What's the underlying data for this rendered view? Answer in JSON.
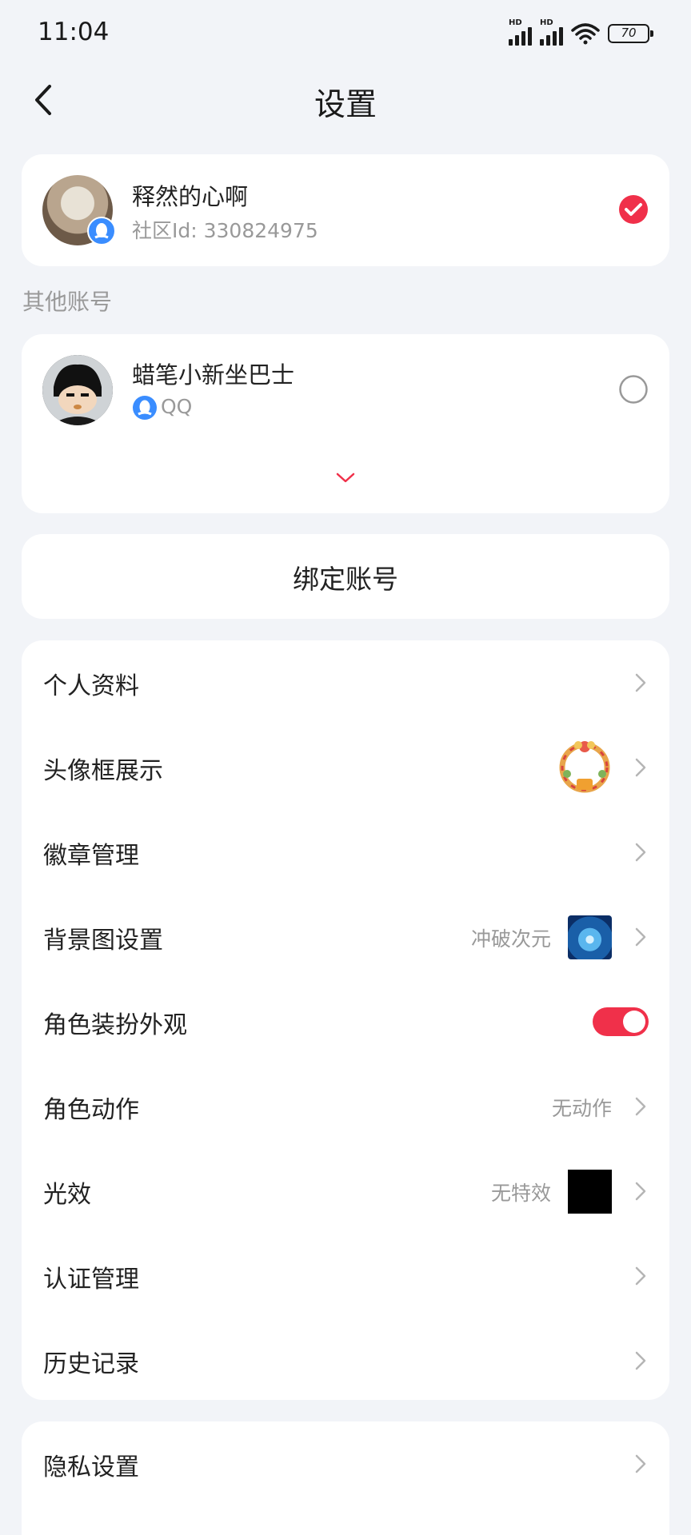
{
  "status": {
    "time": "11:04",
    "battery": "70",
    "hd1": "HD",
    "hd2": "HD"
  },
  "header": {
    "title": "设置"
  },
  "current_account": {
    "name": "释然的心啊",
    "community_id": "社区Id: 330824975"
  },
  "other_accounts": {
    "label": "其他账号",
    "items": [
      {
        "name": "蜡笔小新坐巴士",
        "platform": "QQ"
      }
    ]
  },
  "bind": {
    "label": "绑定账号"
  },
  "settings": {
    "items": [
      {
        "label": "个人资料"
      },
      {
        "label": "头像框展示"
      },
      {
        "label": "徽章管理"
      },
      {
        "label": "背景图设置",
        "value": "冲破次元"
      },
      {
        "label": "角色装扮外观",
        "toggle": true
      },
      {
        "label": "角色动作",
        "value": "无动作"
      },
      {
        "label": "光效",
        "value": "无特效"
      },
      {
        "label": "认证管理"
      },
      {
        "label": "历史记录"
      }
    ]
  },
  "privacy": {
    "label": "隐私设置"
  },
  "colors": {
    "accent": "#f0304a",
    "background": "#f2f4f8",
    "qq_badge": "#3a8dff"
  }
}
